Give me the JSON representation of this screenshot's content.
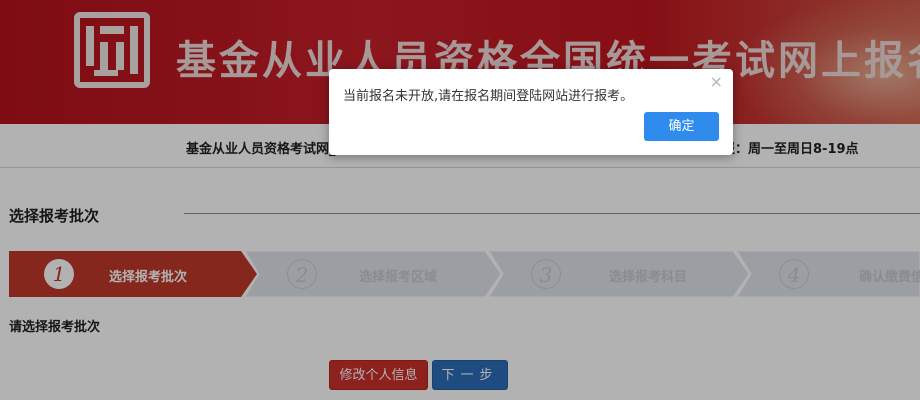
{
  "banner": {
    "title": "基金从业人员资格全国统一考试网上报名"
  },
  "infobar": {
    "left_text": "基金从业人员资格考试网_",
    "right_text": "报：周一至周日8-19点"
  },
  "section": {
    "title": "选择报考批次"
  },
  "steps": [
    {
      "number": "1",
      "label": "选择报考批次",
      "active": true
    },
    {
      "number": "2",
      "label": "选择报考区域",
      "active": false
    },
    {
      "number": "3",
      "label": "选择报考科目",
      "active": false
    },
    {
      "number": "4",
      "label": "确认缴费信",
      "active": false
    }
  ],
  "prompt": "请选择报考批次",
  "buttons": {
    "edit_info": "修改个人信息",
    "next": "下一步"
  },
  "dialog": {
    "message": "当前报名未开放,请在报名期间登陆网站进行报考。",
    "close_icon": "×",
    "ok_label": "确定"
  },
  "colors": {
    "banner_red": "#c8202a",
    "step_active": "#c0392b",
    "step_inactive": "#dfe3e8",
    "edit_button": "#c9302c",
    "next_button": "#2c6eb8",
    "ok_button": "#2f8cec"
  }
}
